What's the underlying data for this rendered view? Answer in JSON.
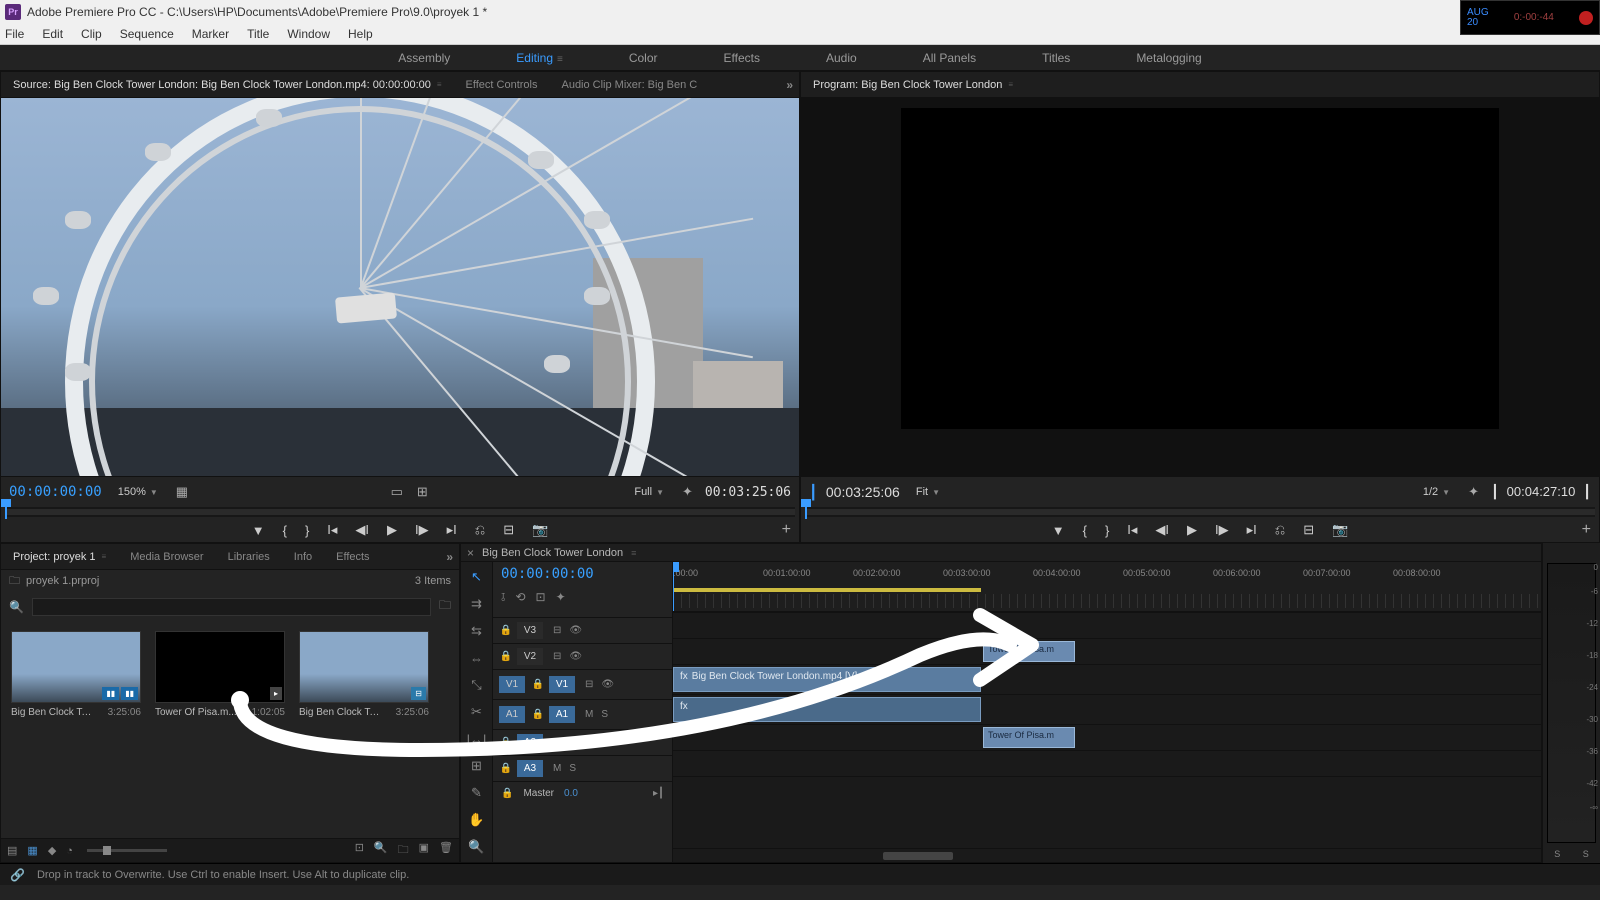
{
  "titlebar": {
    "app_icon": "Pr",
    "title": "Adobe Premiere Pro CC - C:\\Users\\HP\\Documents\\Adobe\\Premiere Pro\\9.0\\proyek 1 *"
  },
  "menu": {
    "file": "File",
    "edit": "Edit",
    "clip": "Clip",
    "sequence": "Sequence",
    "marker": "Marker",
    "title": "Title",
    "window": "Window",
    "help": "Help"
  },
  "workspaces": {
    "assembly": "Assembly",
    "editing": "Editing",
    "color": "Color",
    "effects": "Effects",
    "audio": "Audio",
    "allpanels": "All Panels",
    "titles": "Titles",
    "metalogging": "Metalogging"
  },
  "timecode_corner": {
    "left_label": "AUG",
    "left_num": "20",
    "right": "0:-00:-44"
  },
  "source": {
    "tab": "Source: Big Ben Clock Tower London: Big Ben Clock Tower London.mp4: 00:00:00:00",
    "effectcontrols": "Effect Controls",
    "audiomixer": "Audio Clip Mixer: Big Ben C",
    "tc_in": "00:00:00:00",
    "zoom": "150%",
    "resolution": "Full",
    "tc_out": "00:03:25:06"
  },
  "program": {
    "tab": "Program: Big Ben Clock Tower London",
    "tc_in": "00:03:25:06",
    "resolution": "Fit",
    "fraction": "1/2",
    "tc_out": "00:04:27:10"
  },
  "project": {
    "tab": "Project: proyek 1",
    "mediab": "Media Browser",
    "libraries": "Libraries",
    "info": "Info",
    "effects_tab": "Effects",
    "filename": "proyek 1.prproj",
    "items": "3 Items",
    "bins": [
      {
        "name": "Big Ben Clock Tower...",
        "dur": "3:25:06",
        "type": "video"
      },
      {
        "name": "Tower Of Pisa.m...",
        "dur": "1:02:05",
        "type": "black"
      },
      {
        "name": "Big Ben Clock Tower...",
        "dur": "3:25:06",
        "type": "seq"
      }
    ]
  },
  "timeline": {
    "seq_name": "Big Ben Clock Tower London",
    "tc": "00:00:00:00",
    "ticks": [
      ":00:00",
      "00:01:00:00",
      "00:02:00:00",
      "00:03:00:00",
      "00:04:00:00",
      "00:05:00:00",
      "00:06:00:00",
      "00:07:00:00",
      "00:08:00:00"
    ],
    "tracks": {
      "v3": "V3",
      "v2": "V2",
      "v1a": "V1",
      "v1b": "V1",
      "a1a": "A1",
      "a1b": "A1",
      "a2": "A2",
      "a3": "A3",
      "master": "Master",
      "master_val": "0.0"
    },
    "clip1": "Big Ben Clock Tower London.mp4 [V]",
    "clip2": "Tower Of Pisa.m",
    "clip3": "Tower Of Pisa.m",
    "opts": {
      "m": "M",
      "s": "S"
    }
  },
  "status": {
    "text": "Drop in track to Overwrite. Use Ctrl to enable Insert. Use Alt to duplicate clip."
  },
  "meters": {
    "s": "S"
  }
}
